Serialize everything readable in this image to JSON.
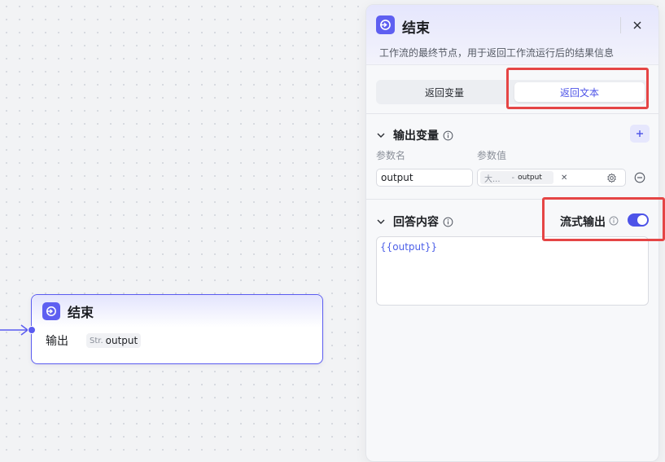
{
  "canvas": {
    "node": {
      "title": "结束",
      "output_label": "输出",
      "output_type": "Str.",
      "output_name": "output"
    }
  },
  "panel": {
    "title": "结束",
    "description": "工作流的最终节点，用于返回工作流运行后的结果信息",
    "tabs": [
      {
        "label": "返回变量",
        "active": false
      },
      {
        "label": "返回文本",
        "active": true
      }
    ],
    "output_section": {
      "title": "输出变量",
      "col_name": "参数名",
      "col_value": "参数值",
      "rows": [
        {
          "name": "output",
          "value_source": "大...",
          "value_dash": "-",
          "value_name": "output"
        }
      ]
    },
    "answer_section": {
      "title": "回答内容",
      "stream_label": "流式输出",
      "stream_enabled": true,
      "content": "{{output}}"
    }
  },
  "colors": {
    "accent": "#5b5cf0",
    "highlight": "#e54545"
  },
  "icons": {
    "node_icon": "exit-node-icon",
    "close": "close-icon",
    "info": "info-icon",
    "chevron": "chevron-down-icon",
    "add": "plus-icon",
    "settings": "gear-icon",
    "remove": "minus-circle-icon"
  }
}
